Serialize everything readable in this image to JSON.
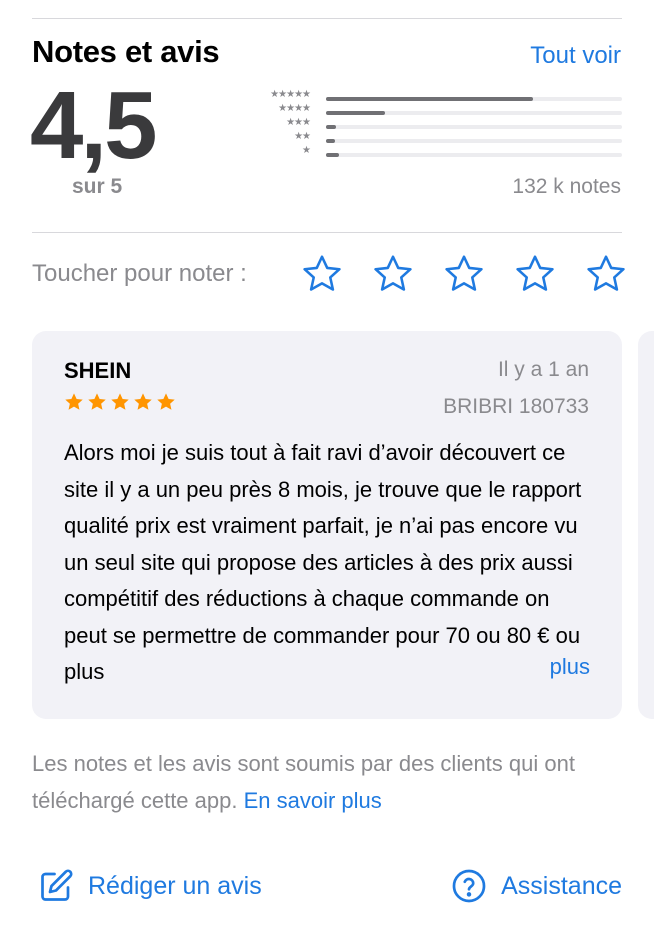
{
  "header": {
    "title": "Notes et avis",
    "see_all_label": "Tout voir"
  },
  "rating": {
    "average": "4,5",
    "out_of": "sur 5",
    "count_label": "132 k notes",
    "histogram": [
      {
        "stars": "★★★★★",
        "fraction": 0.7
      },
      {
        "stars": "★★★★",
        "fraction": 0.2
      },
      {
        "stars": "★★★",
        "fraction": 0.035
      },
      {
        "stars": "★★",
        "fraction": 0.02
      },
      {
        "stars": "★",
        "fraction": 0.045
      }
    ]
  },
  "tap_to_rate": {
    "label": "Toucher pour noter :",
    "star_count": 5,
    "star_color": "#1f7ae0"
  },
  "review": {
    "title": "SHEIN",
    "date": "Il y a 1 an",
    "author": "BRIBRI 180733",
    "rating": 5,
    "star_color": "#ff9500",
    "body": "Alors moi je suis tout à fait ravi d’avoir découvert ce site il y a un peu près 8 mois, je trouve que le rapport qualité prix est vraiment parfait, je n’ai pas encore vu un seul site qui propose des articles à des prix aussi compétitif des réductions à chaque commande on peut se permettre de commander pour 70 ou 80 € ou plus",
    "more_label": "plus"
  },
  "disclaimer": {
    "text": "Les notes et les avis sont soumis par des clients qui ont téléchargé cette app. ",
    "link_label": "En savoir plus"
  },
  "actions": {
    "write_review_label": "Rédiger un avis",
    "support_label": "Assistance"
  },
  "colors": {
    "accent": "#1f7ae0",
    "secondary_text": "#8a8a8e",
    "card_background": "#f2f2f7"
  }
}
